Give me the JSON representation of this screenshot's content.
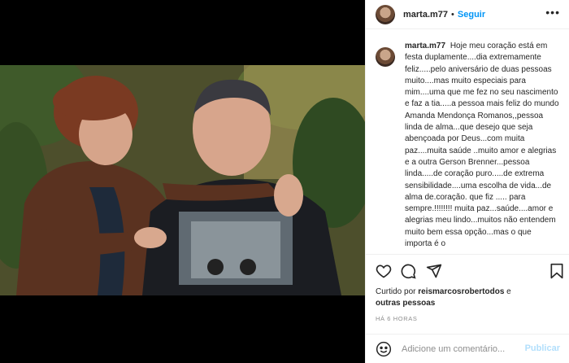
{
  "post": {
    "username": "marta.m77",
    "separator": "•",
    "follow_label": "Seguir",
    "more_label": "•••",
    "caption_user": "marta.m77",
    "caption_text": "Hoje meu coração está em festa duplamente....dia extremamente feliz.....pelo aniversário de duas pessoas muito....mas muito especiais para mim....uma que me fez no seu nascimento e faz a tia.....a pessoa mais feliz do mundo Amanda Mendonça Romanos,,pessoa linda de alma...que desejo que seja abençoada por Deus...com muita paz....muita saúde ..muito amor e alegrias e a outra Gerson Brenner...pessoa linda.....de coração puro.....de extrema sensibilidade....uma escolha de vida...de alma de.coração. que fiz ..... para sempre.!!!!!!!! muita paz...saúde....amor e alegrias meu lindo...muitos não entendem muito bem essa opção...mas o que importa é o",
    "liked_prefix": "Curtido por ",
    "liked_user": "reismarcosrobertodos",
    "liked_suffix": " e",
    "liked_others": "outras pessoas",
    "time_ago": "HÁ 6 HORAS",
    "comment_placeholder": "Adicione um comentário...",
    "publish_label": "Publicar"
  },
  "icons": {
    "like": "heart-icon",
    "comment": "comment-icon",
    "share": "paper-plane-icon",
    "save": "bookmark-icon",
    "emoji": "smiley-icon"
  },
  "colors": {
    "accent": "#0095f6",
    "publish_disabled": "#b2dffc",
    "text": "#262626",
    "muted": "#8e8e8e"
  }
}
